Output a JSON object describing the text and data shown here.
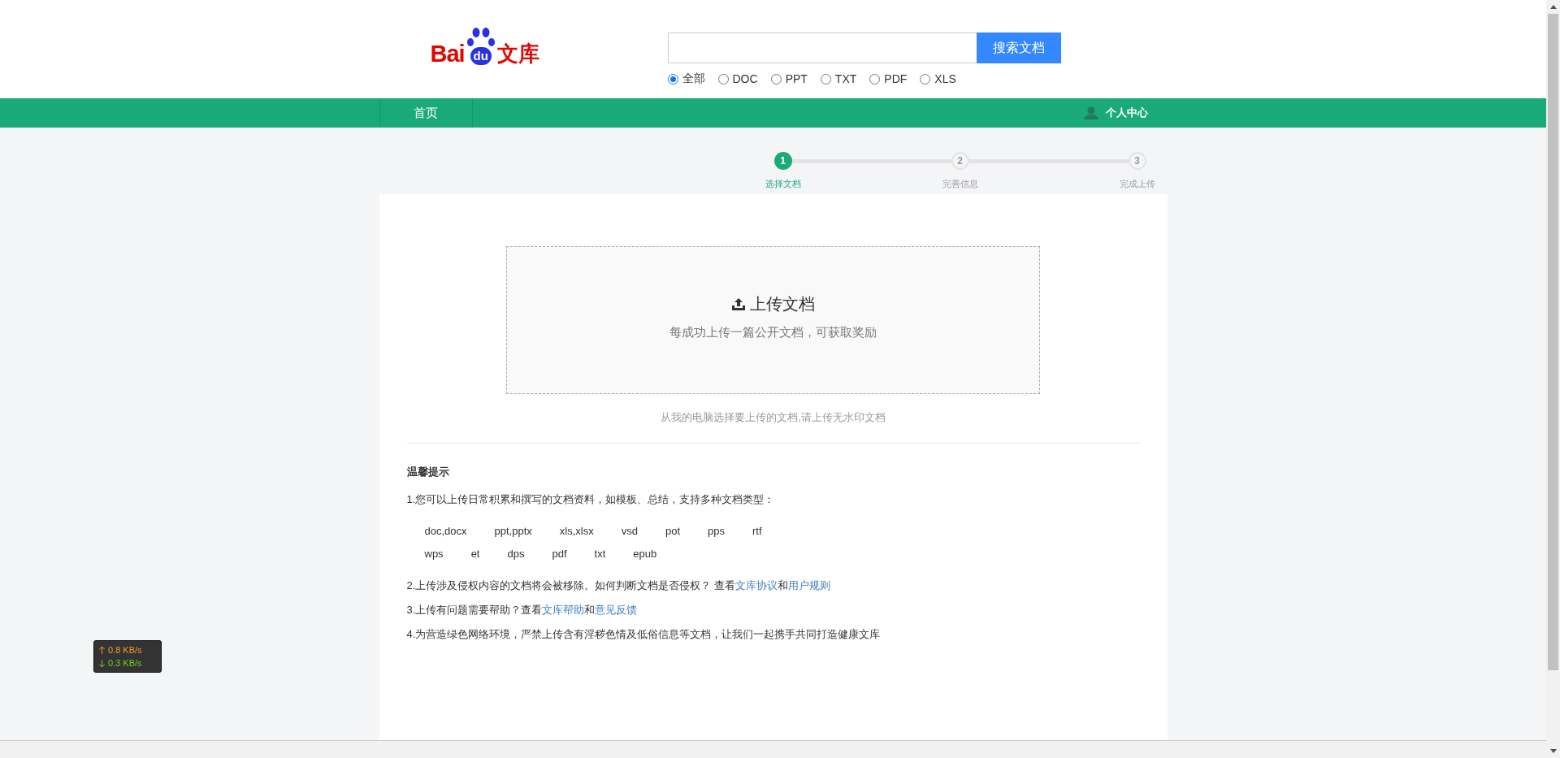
{
  "logo": {
    "left": "Bai",
    "badge": "du",
    "right": "文库"
  },
  "search": {
    "button": "搜索文档",
    "filters": [
      {
        "label": "全部",
        "selected": true
      },
      {
        "label": "DOC",
        "selected": false
      },
      {
        "label": "PPT",
        "selected": false
      },
      {
        "label": "TXT",
        "selected": false
      },
      {
        "label": "PDF",
        "selected": false
      },
      {
        "label": "XLS",
        "selected": false
      }
    ]
  },
  "nav": {
    "items": [
      {
        "label": "首页"
      }
    ],
    "user_link": "个人中心"
  },
  "steps": [
    {
      "number": "1",
      "label": "选择文档",
      "active": true
    },
    {
      "number": "2",
      "label": "完善信息",
      "active": false
    },
    {
      "number": "3",
      "label": "完成上传",
      "active": false
    }
  ],
  "upload": {
    "title": "上传文档",
    "subtitle": "每成功上传一篇公开文档，可获取奖励",
    "hint": "从我的电脑选择要上传的文档,请上传无水印文档"
  },
  "tips": {
    "title": "温馨提示",
    "items": [
      {
        "kind": "text",
        "parts": [
          {
            "text": "1.您可以上传日常积累和撰写的文档资料，如模板、总结，支持多种文档类型："
          }
        ]
      },
      {
        "kind": "formats",
        "items": [
          "doc,docx",
          "ppt,pptx",
          "xls,xlsx",
          "vsd",
          "pot",
          "pps",
          "rtf"
        ]
      },
      {
        "kind": "formats",
        "items": [
          "wps",
          "et",
          "dps",
          "pdf",
          "txt",
          "epub"
        ]
      },
      {
        "kind": "text",
        "parts": [
          {
            "text": "2.上传涉及侵权内容的文档将会被移除。如何判断文档是否侵权？ 查看"
          },
          {
            "link": "文库协议"
          },
          {
            "text": "和"
          },
          {
            "link": "用户规则"
          }
        ]
      },
      {
        "kind": "text",
        "parts": [
          {
            "text": "3.上传有问题需要帮助？查看"
          },
          {
            "link": "文库帮助"
          },
          {
            "text": "和"
          },
          {
            "link": "意见反馈"
          }
        ]
      },
      {
        "kind": "text",
        "parts": [
          {
            "text": "4.为营造绿色网络环境，严禁上传含有淫秽色情及低俗信息等文档，让我们一起携手共同打造健康文库"
          }
        ]
      }
    ]
  },
  "speed_widget": {
    "upload": "0.8 KB/s",
    "download": "0.3 KB/s"
  }
}
